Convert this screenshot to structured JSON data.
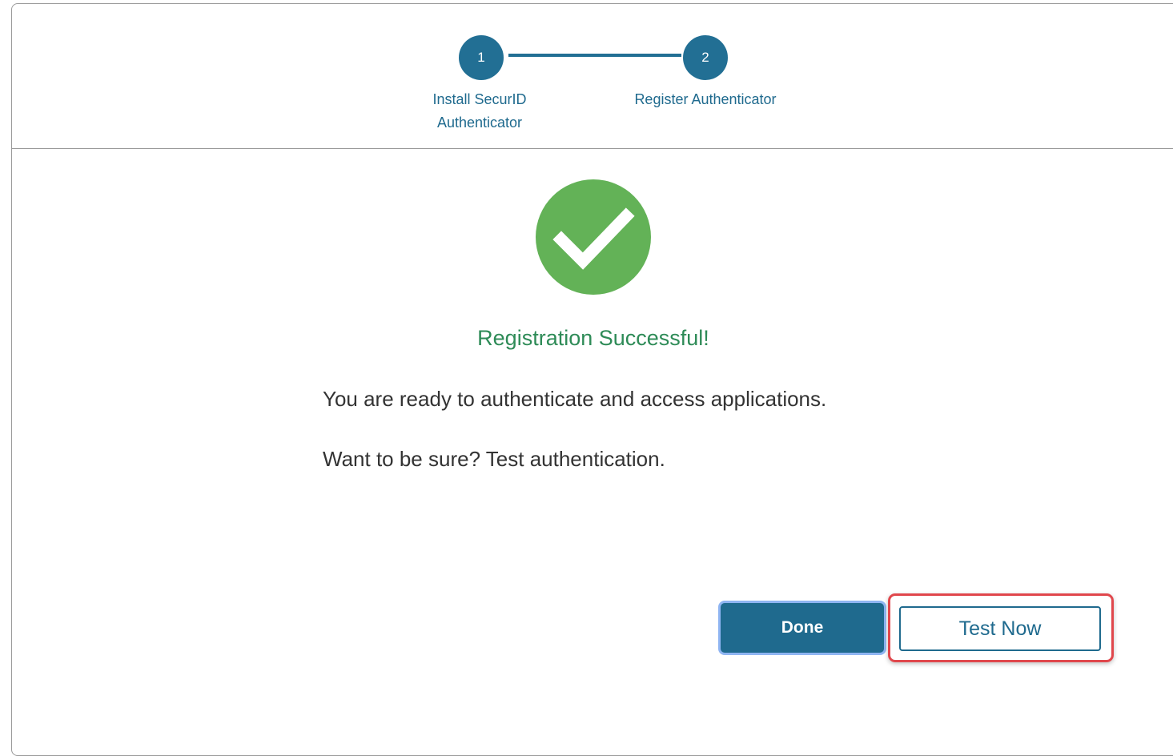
{
  "stepper": {
    "steps": [
      {
        "number": "1",
        "label_line1": "Install SecurID",
        "label_line2": "Authenticator"
      },
      {
        "number": "2",
        "label_line1": "Register Authenticator"
      }
    ],
    "color": "#226f94"
  },
  "result": {
    "icon": "check-circle-icon",
    "icon_color": "#63b257",
    "title": "Registration Successful!",
    "message1": "You are ready to authenticate and access applications.",
    "message2": "Want to be sure? Test authentication."
  },
  "actions": {
    "done_label": "Done",
    "test_now_label": "Test Now",
    "highlight_color": "#e0474c"
  }
}
